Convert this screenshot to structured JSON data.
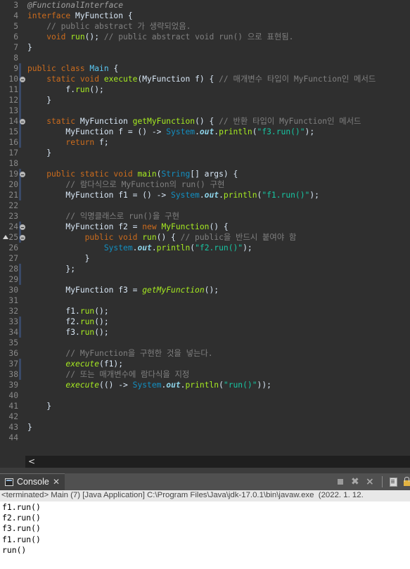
{
  "editor": {
    "lines": [
      {
        "n": "3",
        "segs": [
          {
            "c": "ann",
            "t": "@FunctionalInterface"
          }
        ]
      },
      {
        "n": "4",
        "segs": [
          {
            "c": "kw",
            "t": "interface "
          },
          {
            "c": "plain",
            "t": "MyFunction {"
          }
        ]
      },
      {
        "n": "5",
        "segs": [
          {
            "c": "comment",
            "t": "    // public abstract 가 생략되었음."
          }
        ]
      },
      {
        "n": "6",
        "segs": [
          {
            "c": "kw",
            "t": "    void "
          },
          {
            "c": "method",
            "t": "run"
          },
          {
            "c": "plain",
            "t": "(); "
          },
          {
            "c": "comment",
            "t": "// public abstract void run() 으로 표현됨."
          }
        ]
      },
      {
        "n": "7",
        "segs": [
          {
            "c": "plain",
            "t": "}"
          }
        ]
      },
      {
        "n": "8",
        "segs": []
      },
      {
        "n": "9",
        "segs": [
          {
            "c": "kw",
            "t": "public class "
          },
          {
            "c": "cls",
            "t": "Main"
          },
          {
            "c": "plain",
            "t": " {"
          }
        ]
      },
      {
        "n": "10",
        "fold": true,
        "segs": [
          {
            "c": "kw",
            "t": "    static void "
          },
          {
            "c": "method",
            "t": "execute"
          },
          {
            "c": "plain",
            "t": "(MyFunction "
          },
          {
            "c": "plain",
            "t": "f"
          },
          {
            "c": "plain",
            "t": ") { "
          },
          {
            "c": "comment",
            "t": "// 매개변수 타입이 MyFunction인 메서드"
          }
        ]
      },
      {
        "n": "11",
        "segs": [
          {
            "c": "plain",
            "t": "        f."
          },
          {
            "c": "method",
            "t": "run"
          },
          {
            "c": "plain",
            "t": "();"
          }
        ]
      },
      {
        "n": "12",
        "segs": [
          {
            "c": "plain",
            "t": "    }"
          }
        ]
      },
      {
        "n": "13",
        "segs": []
      },
      {
        "n": "14",
        "fold": true,
        "segs": [
          {
            "c": "kw",
            "t": "    static "
          },
          {
            "c": "plain",
            "t": "MyFunction "
          },
          {
            "c": "method",
            "t": "getMyFunction"
          },
          {
            "c": "plain",
            "t": "() { "
          },
          {
            "c": "comment",
            "t": "// 반환 타입이 MyFunction인 메서드"
          }
        ]
      },
      {
        "n": "15",
        "segs": [
          {
            "c": "plain",
            "t": "        MyFunction f = () -> "
          },
          {
            "c": "type",
            "t": "System"
          },
          {
            "c": "plain",
            "t": "."
          },
          {
            "c": "field",
            "t": "out"
          },
          {
            "c": "plain",
            "t": "."
          },
          {
            "c": "method",
            "t": "println"
          },
          {
            "c": "plain",
            "t": "("
          },
          {
            "c": "str",
            "t": "\"f3.run()\""
          },
          {
            "c": "plain",
            "t": ");"
          }
        ]
      },
      {
        "n": "16",
        "segs": [
          {
            "c": "kw",
            "t": "        return "
          },
          {
            "c": "plain",
            "t": "f;"
          }
        ]
      },
      {
        "n": "17",
        "segs": [
          {
            "c": "plain",
            "t": "    }"
          }
        ]
      },
      {
        "n": "18",
        "segs": []
      },
      {
        "n": "19",
        "fold": true,
        "segs": [
          {
            "c": "kw",
            "t": "    public static void "
          },
          {
            "c": "method",
            "t": "main"
          },
          {
            "c": "plain",
            "t": "("
          },
          {
            "c": "type",
            "t": "String"
          },
          {
            "c": "plain",
            "t": "[] args) {"
          }
        ]
      },
      {
        "n": "20",
        "segs": [
          {
            "c": "comment",
            "t": "        // 람다식으로 MyFunction의 run() 구현"
          }
        ]
      },
      {
        "n": "21",
        "segs": [
          {
            "c": "plain",
            "t": "        MyFunction f1 = () -> "
          },
          {
            "c": "type",
            "t": "System"
          },
          {
            "c": "plain",
            "t": "."
          },
          {
            "c": "field",
            "t": "out"
          },
          {
            "c": "plain",
            "t": "."
          },
          {
            "c": "method",
            "t": "println"
          },
          {
            "c": "plain",
            "t": "("
          },
          {
            "c": "str",
            "t": "\"f1.run()\""
          },
          {
            "c": "plain",
            "t": ");"
          }
        ]
      },
      {
        "n": "22",
        "segs": []
      },
      {
        "n": "23",
        "segs": [
          {
            "c": "comment",
            "t": "        // 익명클래스로 run()을 구현"
          }
        ]
      },
      {
        "n": "24",
        "fold": true,
        "segs": [
          {
            "c": "plain",
            "t": "        MyFunction f2 = "
          },
          {
            "c": "kw",
            "t": "new "
          },
          {
            "c": "method",
            "t": "MyFunction"
          },
          {
            "c": "plain",
            "t": "() {"
          }
        ]
      },
      {
        "n": "25",
        "fold": true,
        "override": true,
        "segs": [
          {
            "c": "kw",
            "t": "            public void "
          },
          {
            "c": "method",
            "t": "run"
          },
          {
            "c": "plain",
            "t": "() { "
          },
          {
            "c": "comment",
            "t": "// public을 반드시 붙여야 함"
          }
        ]
      },
      {
        "n": "26",
        "segs": [
          {
            "c": "type",
            "t": "                System"
          },
          {
            "c": "plain",
            "t": "."
          },
          {
            "c": "field",
            "t": "out"
          },
          {
            "c": "plain",
            "t": "."
          },
          {
            "c": "method",
            "t": "println"
          },
          {
            "c": "plain",
            "t": "("
          },
          {
            "c": "str",
            "t": "\"f2.run()\""
          },
          {
            "c": "plain",
            "t": ");"
          }
        ]
      },
      {
        "n": "27",
        "segs": [
          {
            "c": "plain",
            "t": "            }"
          }
        ]
      },
      {
        "n": "28",
        "segs": [
          {
            "c": "plain",
            "t": "        };"
          }
        ]
      },
      {
        "n": "29",
        "segs": []
      },
      {
        "n": "30",
        "segs": [
          {
            "c": "plain",
            "t": "        MyFunction f3 = "
          },
          {
            "c": "static-m",
            "t": "getMyFunction"
          },
          {
            "c": "plain",
            "t": "();"
          }
        ]
      },
      {
        "n": "31",
        "segs": []
      },
      {
        "n": "32",
        "segs": [
          {
            "c": "plain",
            "t": "        f1."
          },
          {
            "c": "method",
            "t": "run"
          },
          {
            "c": "plain",
            "t": "();"
          }
        ]
      },
      {
        "n": "33",
        "segs": [
          {
            "c": "plain",
            "t": "        f2."
          },
          {
            "c": "method",
            "t": "run"
          },
          {
            "c": "plain",
            "t": "();"
          }
        ]
      },
      {
        "n": "34",
        "segs": [
          {
            "c": "plain",
            "t": "        f3."
          },
          {
            "c": "method",
            "t": "run"
          },
          {
            "c": "plain",
            "t": "();"
          }
        ]
      },
      {
        "n": "35",
        "segs": []
      },
      {
        "n": "36",
        "segs": [
          {
            "c": "comment",
            "t": "        // MyFunction을 구현한 것을 넣는다."
          }
        ]
      },
      {
        "n": "37",
        "segs": [
          {
            "c": "static-m",
            "t": "        execute"
          },
          {
            "c": "plain",
            "t": "(f1);"
          }
        ]
      },
      {
        "n": "38",
        "segs": [
          {
            "c": "comment",
            "t": "        // 또는 매개변수에 람다식을 지정"
          }
        ]
      },
      {
        "n": "39",
        "segs": [
          {
            "c": "static-m",
            "t": "        execute"
          },
          {
            "c": "plain",
            "t": "(() -> "
          },
          {
            "c": "type",
            "t": "System"
          },
          {
            "c": "plain",
            "t": "."
          },
          {
            "c": "field",
            "t": "out"
          },
          {
            "c": "plain",
            "t": "."
          },
          {
            "c": "method",
            "t": "println"
          },
          {
            "c": "plain",
            "t": "("
          },
          {
            "c": "str",
            "t": "\"run()\""
          },
          {
            "c": "plain",
            "t": "));"
          }
        ]
      },
      {
        "n": "40",
        "segs": []
      },
      {
        "n": "41",
        "segs": [
          {
            "c": "plain",
            "t": "    }"
          }
        ]
      },
      {
        "n": "42",
        "segs": []
      },
      {
        "n": "43",
        "segs": [
          {
            "c": "plain",
            "t": "}"
          }
        ]
      },
      {
        "n": "44",
        "segs": []
      }
    ]
  },
  "hscroll": {
    "arrow": "<"
  },
  "console": {
    "tab_label": "Console",
    "tab_close": "✕",
    "toolbar": {
      "remove_launch": "✖",
      "remove_all": "⨯"
    },
    "status": "<terminated> Main (7) [Java Application] C:\\Program Files\\Java\\jdk-17.0.1\\bin\\javaw.exe  (2022. 1. 12.",
    "output": [
      "f1.run()",
      "f2.run()",
      "f3.run()",
      "f1.run()",
      "run()"
    ]
  },
  "colors": {
    "editor_bg": "#2f2f2f",
    "keyword": "#cc6c1d",
    "method": "#a7ec21",
    "string": "#17c6a3",
    "comment": "#808080",
    "type": "#1290c3",
    "console_bg": "#ffffff"
  },
  "icons": {
    "console_tab": "console-icon",
    "terminate": "terminate-icon",
    "remove_launch": "remove-launch-icon",
    "remove_all": "remove-all-terminated-icon",
    "pin": "pin-console-icon",
    "lock": "scroll-lock-icon"
  }
}
